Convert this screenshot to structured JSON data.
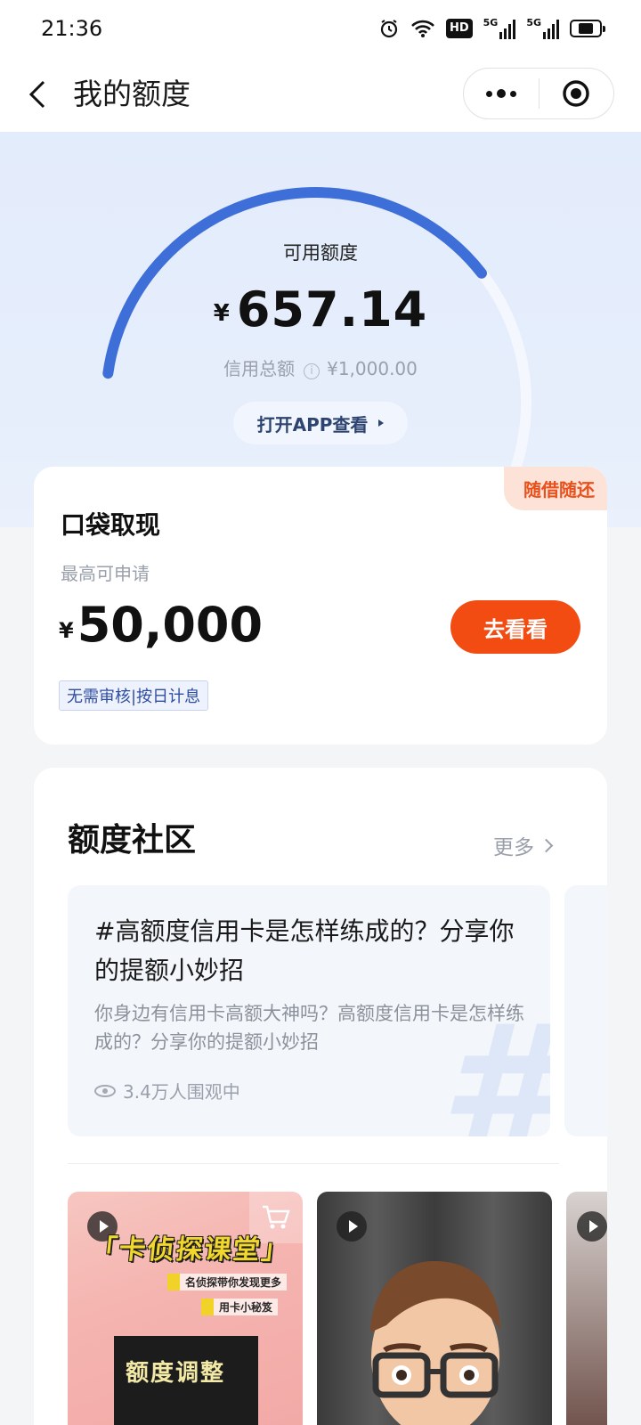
{
  "status_bar": {
    "time": "21:36",
    "icons": [
      "alarm-icon",
      "wifi-icon",
      "hd-icon",
      "signal-5g-icon",
      "signal-5g-icon",
      "battery-icon"
    ],
    "hd_label": "HD",
    "network_label": "5G"
  },
  "nav": {
    "title": "我的额度",
    "back_icon": "chevron-left-icon",
    "more_icon": "more-dots-icon",
    "close_icon": "target-circle-icon"
  },
  "hero": {
    "label": "可用额度",
    "currency": "¥",
    "available": "657.14",
    "total_label": "信用总额",
    "total_value": "¥1,000.00",
    "info_icon": "info-icon",
    "usage_fraction": 0.657,
    "open_app": "打开APP查看"
  },
  "cash_card": {
    "badge": "随借随还",
    "title": "口袋取现",
    "subtitle": "最高可申请",
    "currency": "¥",
    "amount": "50,000",
    "button": "去看看",
    "tag": "无需审核|按日计息"
  },
  "community": {
    "title": "额度社区",
    "more": "更多",
    "topic": {
      "title": "#高额度信用卡是怎样练成的？分享你的提额小妙招",
      "desc": "你身边有信用卡高额大神吗？高额度信用卡是怎样练成的？分享你的提额小妙招",
      "views": "3.4万人围观中"
    },
    "thumb1": {
      "headline": "「卡侦探课堂」",
      "line1": "名侦探带你发现更多",
      "line2": "用卡小秘笈",
      "panel_text": "额度调整"
    }
  },
  "colors": {
    "accent_blue": "#3e6fd8",
    "hero_bg": "#e4edfb",
    "orange": "#f34c12",
    "badge_bg": "#fde3d7"
  }
}
